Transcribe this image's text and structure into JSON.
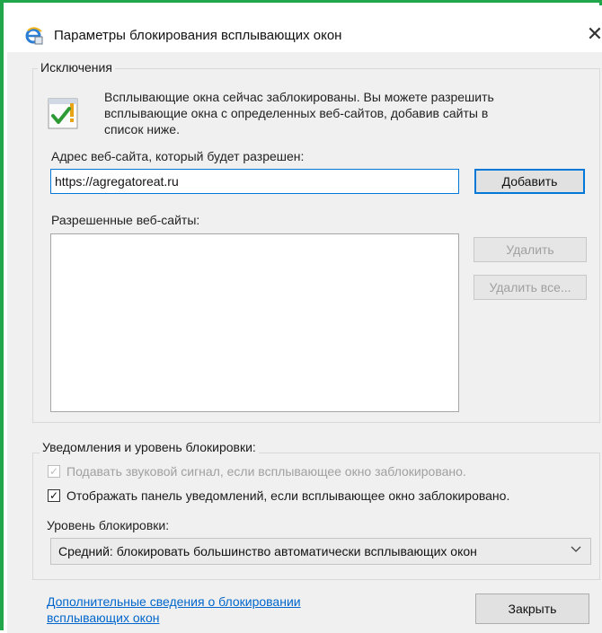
{
  "window": {
    "title": "Параметры блокирования всплывающих окон",
    "close_label": "✕",
    "icon": "internet-explorer-settings-icon"
  },
  "exceptions": {
    "group_title": "Исключения",
    "info_icon": "allowed-popup-icon",
    "info_text": "Всплывающие окна сейчас заблокированы. Вы можете разрешить всплывающие окна с определенных веб-сайтов, добавив сайты в список ниже.",
    "address_label": "Адрес веб-сайта, который будет разрешен:",
    "address_value": "https://agregatoreat.ru",
    "add_button": "Добавить",
    "allowed_label": "Разрешенные веб-сайты:",
    "allowed_sites": [],
    "remove_button": "Удалить",
    "remove_all_button": "Удалить все..."
  },
  "notifications": {
    "group_title": "Уведомления и уровень блокировки:",
    "sound_checkbox": {
      "label": "Подавать звуковой сигнал, если всплывающее окно заблокировано.",
      "checked": true,
      "enabled": false
    },
    "bar_checkbox": {
      "label": "Отображать панель уведомлений, если всплывающее окно заблокировано.",
      "checked": true,
      "enabled": true
    },
    "level_label": "Уровень блокировки:",
    "level_value": "Средний: блокировать большинство автоматически всплывающих окон"
  },
  "footer": {
    "more_info_link": "Дополнительные сведения о блокировании всплывающих окон",
    "close_button": "Закрыть"
  },
  "colors": {
    "accent": "#0078d7",
    "link": "#0066cc",
    "frame": "#22a64a"
  }
}
